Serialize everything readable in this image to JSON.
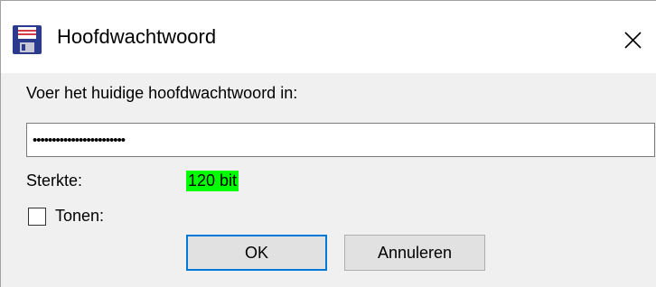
{
  "window": {
    "title": "Hoofdwachtwoord",
    "app_icon": "floppy-disk-icon",
    "close_icon": "close-icon"
  },
  "prompt": "Voer het huidige hoofdwachtwoord in:",
  "password": {
    "masked_value": "••••••••••••••••••••••••"
  },
  "strength": {
    "label": "Sterkte:",
    "value": "120 bit",
    "color": "#00ff00"
  },
  "show": {
    "label": "Tonen:",
    "checked": false
  },
  "buttons": {
    "ok_label": "OK",
    "cancel_label": "Annuleren"
  },
  "colors": {
    "focus_border": "#0078d7",
    "dialog_bg": "#f0f0f0"
  }
}
